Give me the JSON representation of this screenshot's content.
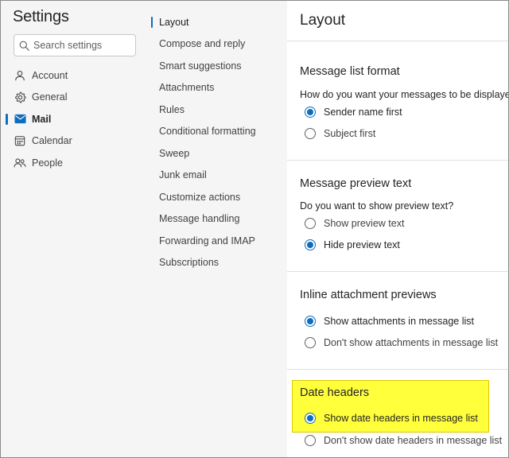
{
  "left": {
    "title": "Settings",
    "search": {
      "placeholder": "Search settings"
    },
    "categories": [
      {
        "label": "Account",
        "icon": "person-icon"
      },
      {
        "label": "General",
        "icon": "gear-icon"
      },
      {
        "label": "Mail",
        "icon": "mail-icon",
        "active": true
      },
      {
        "label": "Calendar",
        "icon": "calendar-icon"
      },
      {
        "label": "People",
        "icon": "people-icon"
      }
    ]
  },
  "middle": {
    "items": [
      "Layout",
      "Compose and reply",
      "Smart suggestions",
      "Attachments",
      "Rules",
      "Conditional formatting",
      "Sweep",
      "Junk email",
      "Customize actions",
      "Message handling",
      "Forwarding and IMAP",
      "Subscriptions"
    ],
    "active_index": 0
  },
  "right": {
    "title": "Layout",
    "message_list_format": {
      "title": "Message list format",
      "question": "How do you want your messages to be displayed?",
      "options": [
        "Sender name first",
        "Subject first"
      ],
      "selected": 0
    },
    "message_preview_text": {
      "title": "Message preview text",
      "question": "Do you want to show preview text?",
      "options": [
        "Show preview text",
        "Hide preview text"
      ],
      "selected": 1
    },
    "inline_attachment_previews": {
      "title": "Inline attachment previews",
      "options": [
        "Show attachments in message list",
        "Don't show attachments in message list"
      ],
      "selected": 0
    },
    "date_headers": {
      "title": "Date headers",
      "options": [
        "Show date headers in message list",
        "Don't show date headers in message list"
      ],
      "selected": 0
    }
  },
  "colors": {
    "accent": "#0f6cbd",
    "highlight": "#ffff3c",
    "pane_bg": "#f5f5f5"
  }
}
